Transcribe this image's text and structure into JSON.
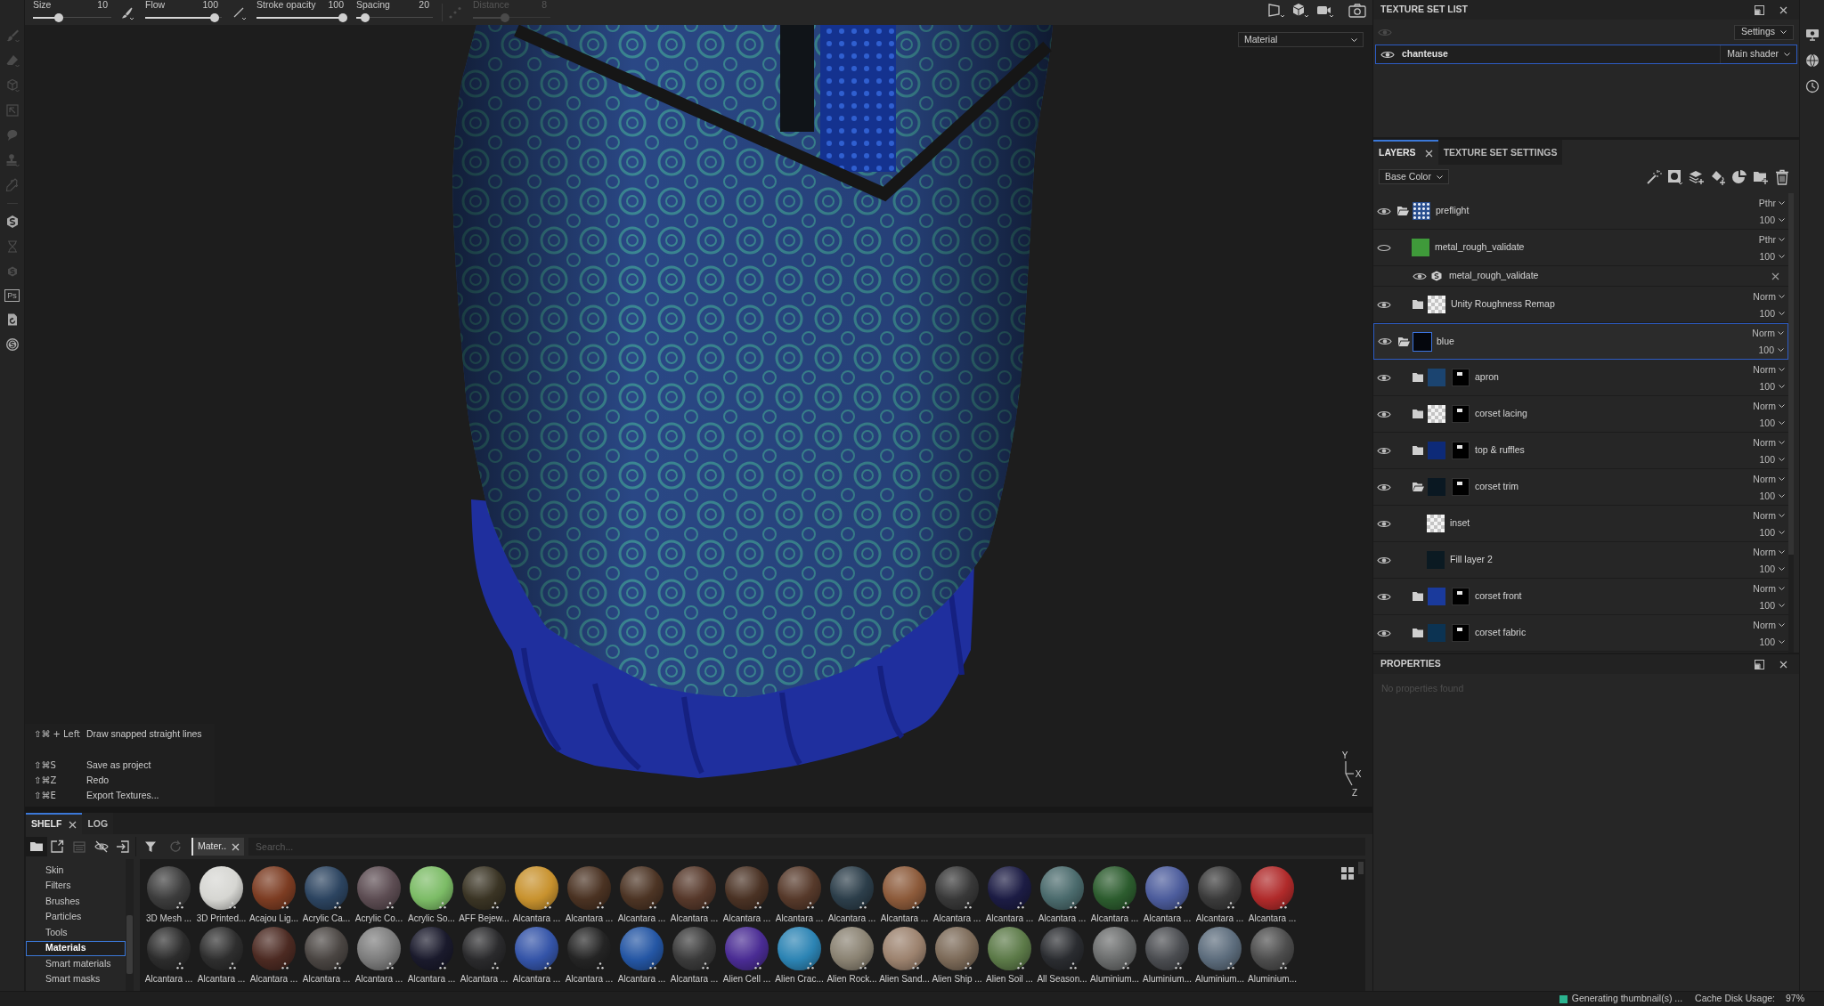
{
  "toolbar": {
    "sliders": [
      {
        "label": "Size",
        "value": "10",
        "level": 0.31,
        "disabled": false
      },
      {
        "label": "Flow",
        "value": "100",
        "level": 0.96,
        "disabled": false
      },
      {
        "label": "Stroke opacity",
        "value": "100",
        "level": 1,
        "disabled": false
      },
      {
        "label": "Spacing",
        "value": "20",
        "level": 0.07,
        "disabled": false
      },
      {
        "label": "Distance",
        "value": "8",
        "level": 0.4,
        "disabled": true
      }
    ]
  },
  "tool_strip": {
    "tools": [
      {
        "kind": "icon",
        "disabled": true
      },
      {
        "kind": "icon",
        "disabled": true
      },
      {
        "kind": "icon",
        "disabled": true
      },
      {
        "kind": "icon",
        "disabled": true
      },
      {
        "kind": "icon",
        "disabled": true
      },
      {
        "kind": "icon",
        "disabled": true
      },
      {
        "kind": "icon",
        "disabled": true
      },
      {
        "kind": "icon",
        "disabled": false
      },
      {
        "kind": "icon",
        "disabled": true
      },
      {
        "kind": "icon",
        "disabled": true
      },
      {
        "kind": "label",
        "label": "Ps",
        "disabled": false
      },
      {
        "kind": "icon",
        "disabled": false
      },
      {
        "kind": "icon",
        "disabled": false
      }
    ]
  },
  "viewport": {
    "view_dropdown": "Material",
    "shortcut_groups": [
      {
        "items": [
          {
            "keys": "⇧⌘ + Left",
            "action": "Draw snapped straight lines"
          }
        ]
      },
      {
        "items": [
          {
            "keys": "⇧⌘S",
            "action": "Save as project"
          },
          {
            "keys": "⇧⌘Z",
            "action": "Redo"
          },
          {
            "keys": "⇧⌘E",
            "action": "Export Textures..."
          }
        ]
      }
    ],
    "axes": [
      "Y",
      "X",
      "Z"
    ]
  },
  "texture_set_list": {
    "title": "TEXTURE SET LIST",
    "settings_button": "Settings",
    "sets": [
      {
        "name": "chanteuse",
        "shader": "Main shader",
        "selected": true,
        "visible": true
      }
    ]
  },
  "layers_panel": {
    "tabs": [
      {
        "label": "LAYERS",
        "selected": true,
        "closable": true
      },
      {
        "label": "TEXTURE SET SETTINGS",
        "selected": false,
        "closable": false
      }
    ],
    "channel": "Base Color",
    "layers": [
      {
        "kind": "folder",
        "name": "preflight",
        "visible": true,
        "expanded": true,
        "selected": false,
        "blend": "Pthr",
        "opacity": "100",
        "thumbnail": {
          "kind": "dotted",
          "color": "#2a4f8f"
        },
        "mask": false,
        "children": [
          {
            "kind": "layer",
            "name": "metal_rough_validate",
            "visible": false,
            "selected": false,
            "blend": "Pthr",
            "opacity": "100",
            "thumbnail": {
              "kind": "swatch",
              "color": "#3f9a3a"
            },
            "mask": false,
            "effects": [
              {
                "name": "metal_rough_validate",
                "visible": true
              }
            ]
          },
          {
            "kind": "folder",
            "name": "Unity Roughness Remap",
            "visible": true,
            "expanded": false,
            "selected": false,
            "blend": "Norm",
            "opacity": "100",
            "thumbnail": {
              "kind": "checker"
            },
            "mask": false
          }
        ]
      },
      {
        "kind": "folder",
        "name": "blue",
        "visible": true,
        "expanded": true,
        "selected": true,
        "blend": "Norm",
        "opacity": "100",
        "thumbnail": {
          "kind": "swatch",
          "color": "#05070d"
        },
        "mask": false,
        "children": [
          {
            "kind": "folder",
            "name": "apron",
            "visible": true,
            "expanded": false,
            "selected": false,
            "blend": "Norm",
            "opacity": "100",
            "thumbnail": {
              "kind": "swatch",
              "color": "#1b4470"
            },
            "mask": true
          },
          {
            "kind": "folder",
            "name": "corset lacing",
            "visible": true,
            "expanded": false,
            "selected": false,
            "blend": "Norm",
            "opacity": "100",
            "thumbnail": {
              "kind": "checker"
            },
            "mask": true
          },
          {
            "kind": "folder",
            "name": "top & ruffles",
            "visible": true,
            "expanded": false,
            "selected": false,
            "blend": "Norm",
            "opacity": "100",
            "thumbnail": {
              "kind": "swatch",
              "color": "#0d2a78"
            },
            "mask": true
          },
          {
            "kind": "folder",
            "name": "corset trim",
            "visible": true,
            "expanded": true,
            "selected": false,
            "blend": "Norm",
            "opacity": "100",
            "thumbnail": {
              "kind": "swatch",
              "color": "#0a1822"
            },
            "mask": true,
            "children": [
              {
                "kind": "layer",
                "name": "inset",
                "visible": true,
                "selected": false,
                "blend": "Norm",
                "opacity": "100",
                "thumbnail": {
                  "kind": "checker"
                },
                "mask": false
              },
              {
                "kind": "layer",
                "name": "Fill layer 2",
                "visible": true,
                "selected": false,
                "blend": "Norm",
                "opacity": "100",
                "thumbnail": {
                  "kind": "swatch",
                  "color": "#0b1a22"
                },
                "mask": false
              }
            ]
          },
          {
            "kind": "folder",
            "name": "corset front",
            "visible": true,
            "expanded": false,
            "selected": false,
            "blend": "Norm",
            "opacity": "100",
            "thumbnail": {
              "kind": "swatch",
              "color": "#1a3a9c"
            },
            "mask": true
          },
          {
            "kind": "folder",
            "name": "corset fabric",
            "visible": true,
            "expanded": false,
            "selected": false,
            "blend": "Norm",
            "opacity": "100",
            "thumbnail": {
              "kind": "swatch",
              "color": "#0c3352"
            },
            "mask": true
          }
        ]
      }
    ]
  },
  "properties": {
    "title": "PROPERTIES",
    "message": "No properties found"
  },
  "shelf": {
    "tabs": [
      {
        "label": "SHELF",
        "selected": true,
        "closable": true
      },
      {
        "label": "LOG",
        "selected": false,
        "closable": false
      }
    ],
    "categories": [
      {
        "label": "Skin",
        "selected": false
      },
      {
        "label": "Filters",
        "selected": false
      },
      {
        "label": "Brushes",
        "selected": false
      },
      {
        "label": "Particles",
        "selected": false
      },
      {
        "label": "Tools",
        "selected": false
      },
      {
        "label": "Materials",
        "selected": true
      },
      {
        "label": "Smart materials",
        "selected": false
      },
      {
        "label": "Smart masks",
        "selected": false
      }
    ],
    "filter_chip": "Mater..",
    "search": {
      "placeholder": "Search..."
    },
    "materials": [
      {
        "label": "3D Mesh ...",
        "color": "#3c3c3c"
      },
      {
        "label": "3D Printed...",
        "color": "#d6d6d2"
      },
      {
        "label": "Acajou Lig...",
        "color": "#7c3c22"
      },
      {
        "label": "Acrylic Ca...",
        "color": "#2c4460"
      },
      {
        "label": "Acrylic Co...",
        "color": "#5c4c52"
      },
      {
        "label": "Acrylic So...",
        "color": "#7cbc66"
      },
      {
        "label": "AFF Bejew...",
        "color": "#3a3424"
      },
      {
        "label": "Alcantara ...",
        "color": "#c8922e"
      },
      {
        "label": "Alcantara ...",
        "color": "#4a3222"
      },
      {
        "label": "Alcantara ...",
        "color": "#4c3424"
      },
      {
        "label": "Alcantara ...",
        "color": "#56382a"
      },
      {
        "label": "Alcantara ...",
        "color": "#4a3224"
      },
      {
        "label": "Alcantara ...",
        "color": "#56392a"
      },
      {
        "label": "Alcantara ...",
        "color": "#2c3e4a"
      },
      {
        "label": "Alcantara ...",
        "color": "#8c5a3a"
      },
      {
        "label": "Alcantara ...",
        "color": "#383838"
      },
      {
        "label": "Alcantara ...",
        "color": "#1c1c44"
      },
      {
        "label": "Alcantara ...",
        "color": "#4a6a6c"
      },
      {
        "label": "Alcantara ...",
        "color": "#2c5c2e"
      },
      {
        "label": "Alcantara ...",
        "color": "#4c5c9c"
      },
      {
        "label": "Alcantara ...",
        "color": "#3a3a3a"
      },
      {
        "label": "Alcantara ...",
        "color": "#b02a2a"
      },
      {
        "label": "Alcantara ...",
        "color": "#2c2c2c"
      },
      {
        "label": "Alcantara ...",
        "color": "#2e2e2e"
      },
      {
        "label": "Alcantara ...",
        "color": "#4c2a22"
      },
      {
        "label": "Alcantara ...",
        "color": "#4a4542"
      },
      {
        "label": "Alcantara ...",
        "color": "#7c7c7c"
      },
      {
        "label": "Alcantara ...",
        "color": "#1a1a2c"
      },
      {
        "label": "Alcantara ...",
        "color": "#2a2a2c"
      },
      {
        "label": "Alcantara ...",
        "color": "#3454a8"
      },
      {
        "label": "Alcantara ...",
        "color": "#242424"
      },
      {
        "label": "Alcantara ...",
        "color": "#2456a4"
      },
      {
        "label": "Alcantara ...",
        "color": "#3a3a3a"
      },
      {
        "label": "Alien Cell ...",
        "color": "#4a2c94"
      },
      {
        "label": "Alien Crac...",
        "color": "#2c84b4"
      },
      {
        "label": "Alien Rock...",
        "color": "#8a8272"
      },
      {
        "label": "Alien Sand...",
        "color": "#9c826e"
      },
      {
        "label": "Alien Ship ...",
        "color": "#7c6a58"
      },
      {
        "label": "Alien Soil ...",
        "color": "#5c7a48"
      },
      {
        "label": "All Season...",
        "color": "#2a2c30"
      },
      {
        "label": "Aluminium...",
        "color": "#6a6c6c"
      },
      {
        "label": "Aluminium...",
        "color": "#4a4c50"
      },
      {
        "label": "Aluminium...",
        "color": "#5c6c7c"
      },
      {
        "label": "Aluminium...",
        "color": "#4c4c4c"
      }
    ]
  },
  "status_bar": {
    "message": "Generating thumbnail(s) ...",
    "cache_label": "Cache Disk Usage:",
    "cache_value": "97%"
  }
}
